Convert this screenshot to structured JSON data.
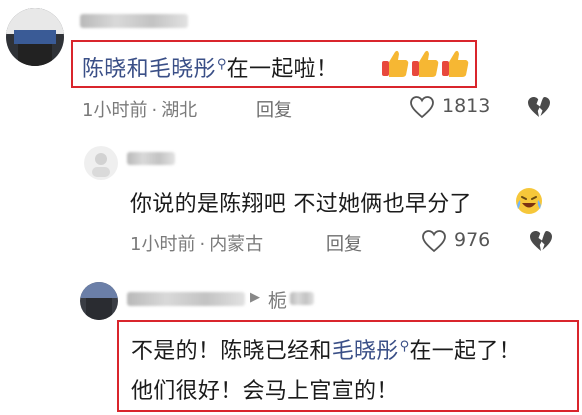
{
  "comment1": {
    "text_name": "陈晓和毛晓彤",
    "text_rest": "在一起啦！",
    "emojis": [
      "thumbs-up-emoji",
      "thumbs-up-emoji",
      "thumbs-up-emoji"
    ],
    "time": "1小时前",
    "location": "湖北",
    "reply_label": "回复",
    "like_count": "1813"
  },
  "reply1": {
    "text": "你说的是陈翔吧 不过她俩也早分了",
    "emoji": "crying-laughing-emoji",
    "time": "1小时前",
    "location": "内蒙古",
    "reply_label": "回复",
    "like_count": "976"
  },
  "reply2": {
    "reply_target": "栀",
    "line1_prefix": "不是的！陈晓已经和",
    "line1_name": "毛晓彤",
    "line1_suffix": "在一起了！",
    "line2": "他们很好！会马上官宣的！"
  },
  "colors": {
    "highlight_border": "#d9252c",
    "link_name": "#3a4f87",
    "meta_text": "#7a7a7a"
  }
}
